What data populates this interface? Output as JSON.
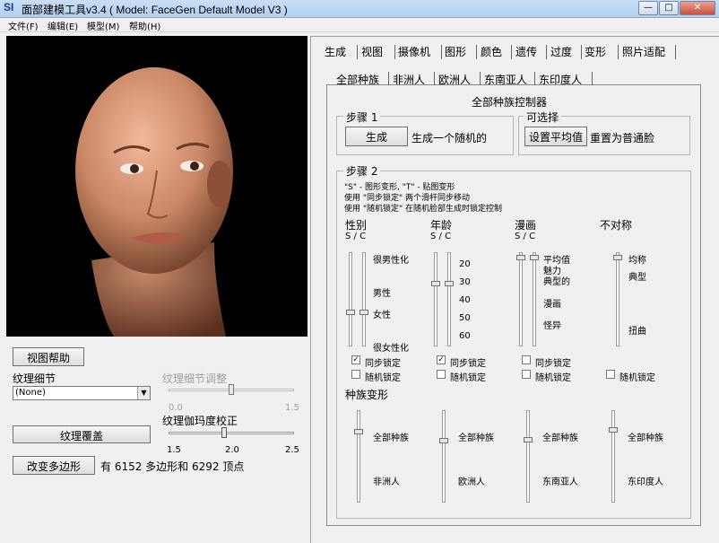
{
  "window": {
    "logo": "SI",
    "title": "面部建模工具v3.4  ( Model: FaceGen Default Model V3 )",
    "min": "—",
    "max": "□",
    "close": "✕"
  },
  "menu": [
    "文件(F)",
    "编辑(E)",
    "模型(M)",
    "帮助(H)"
  ],
  "left": {
    "view_help": "视图帮助",
    "texture_detail_label": "纹理细节",
    "texture_select_value": "(None)",
    "texture_adjust_label": "纹理细节调整",
    "texture_adjust_ticks": [
      "0.0",
      "1.5"
    ],
    "texture_adjust_value": 0.75,
    "gamma_label": "纹理伽玛度校正",
    "gamma_ticks": [
      "1.5",
      "2.0",
      "2.5"
    ],
    "gamma_value": 1.94,
    "texture_cover": "纹理覆盖",
    "change_poly": "改变多边形",
    "poly_info": "有 6152 多边形和 6292 顶点"
  },
  "tabs": [
    "生成",
    "视图",
    "摄像机",
    "图形",
    "颜色",
    "遗传",
    "过度",
    "变形",
    "照片适配"
  ],
  "subtabs": [
    "全部种族",
    "非洲人",
    "欧洲人",
    "东南亚人",
    "东印度人"
  ],
  "panel": {
    "heading": "全部种族控制器",
    "step1": "步骤 1",
    "generate_btn": "生成",
    "generate_desc": "生成一个随机的",
    "optional": "可选择",
    "set_avg_btn": "设置平均值",
    "reset_desc": "重置为普通脸",
    "step2": "步骤 2",
    "notes": [
      "\"S\" - 图形变形, \"T\" - 贴图变形",
      "使用 \"同步锁定\" 两个滑杆同步移动",
      "使用 \"随机锁定\" 在随机脸部生成时锁定控制"
    ],
    "groups": [
      {
        "title": "性别",
        "sc": "S / C",
        "labels": [
          "很男性化",
          "男性",
          "女性",
          "很女性化"
        ]
      },
      {
        "title": "年龄",
        "sc": "S / C",
        "labels": [
          "20",
          "30",
          "40",
          "50",
          "60"
        ]
      },
      {
        "title": "漫画",
        "sc": "S / C",
        "labels": [
          "平均值",
          "魅力",
          "典型的",
          "漫画",
          "怪异"
        ]
      },
      {
        "title": "不对称",
        "sc": "",
        "labels": [
          "均称",
          "典型",
          "扭曲"
        ]
      }
    ],
    "sync_lock": "同步锁定",
    "random_lock": "随机锁定",
    "race_morph": "种族变形",
    "race_top": "全部种族",
    "race_bottom": [
      "非洲人",
      "欧洲人",
      "东南亚人",
      "东印度人"
    ]
  }
}
